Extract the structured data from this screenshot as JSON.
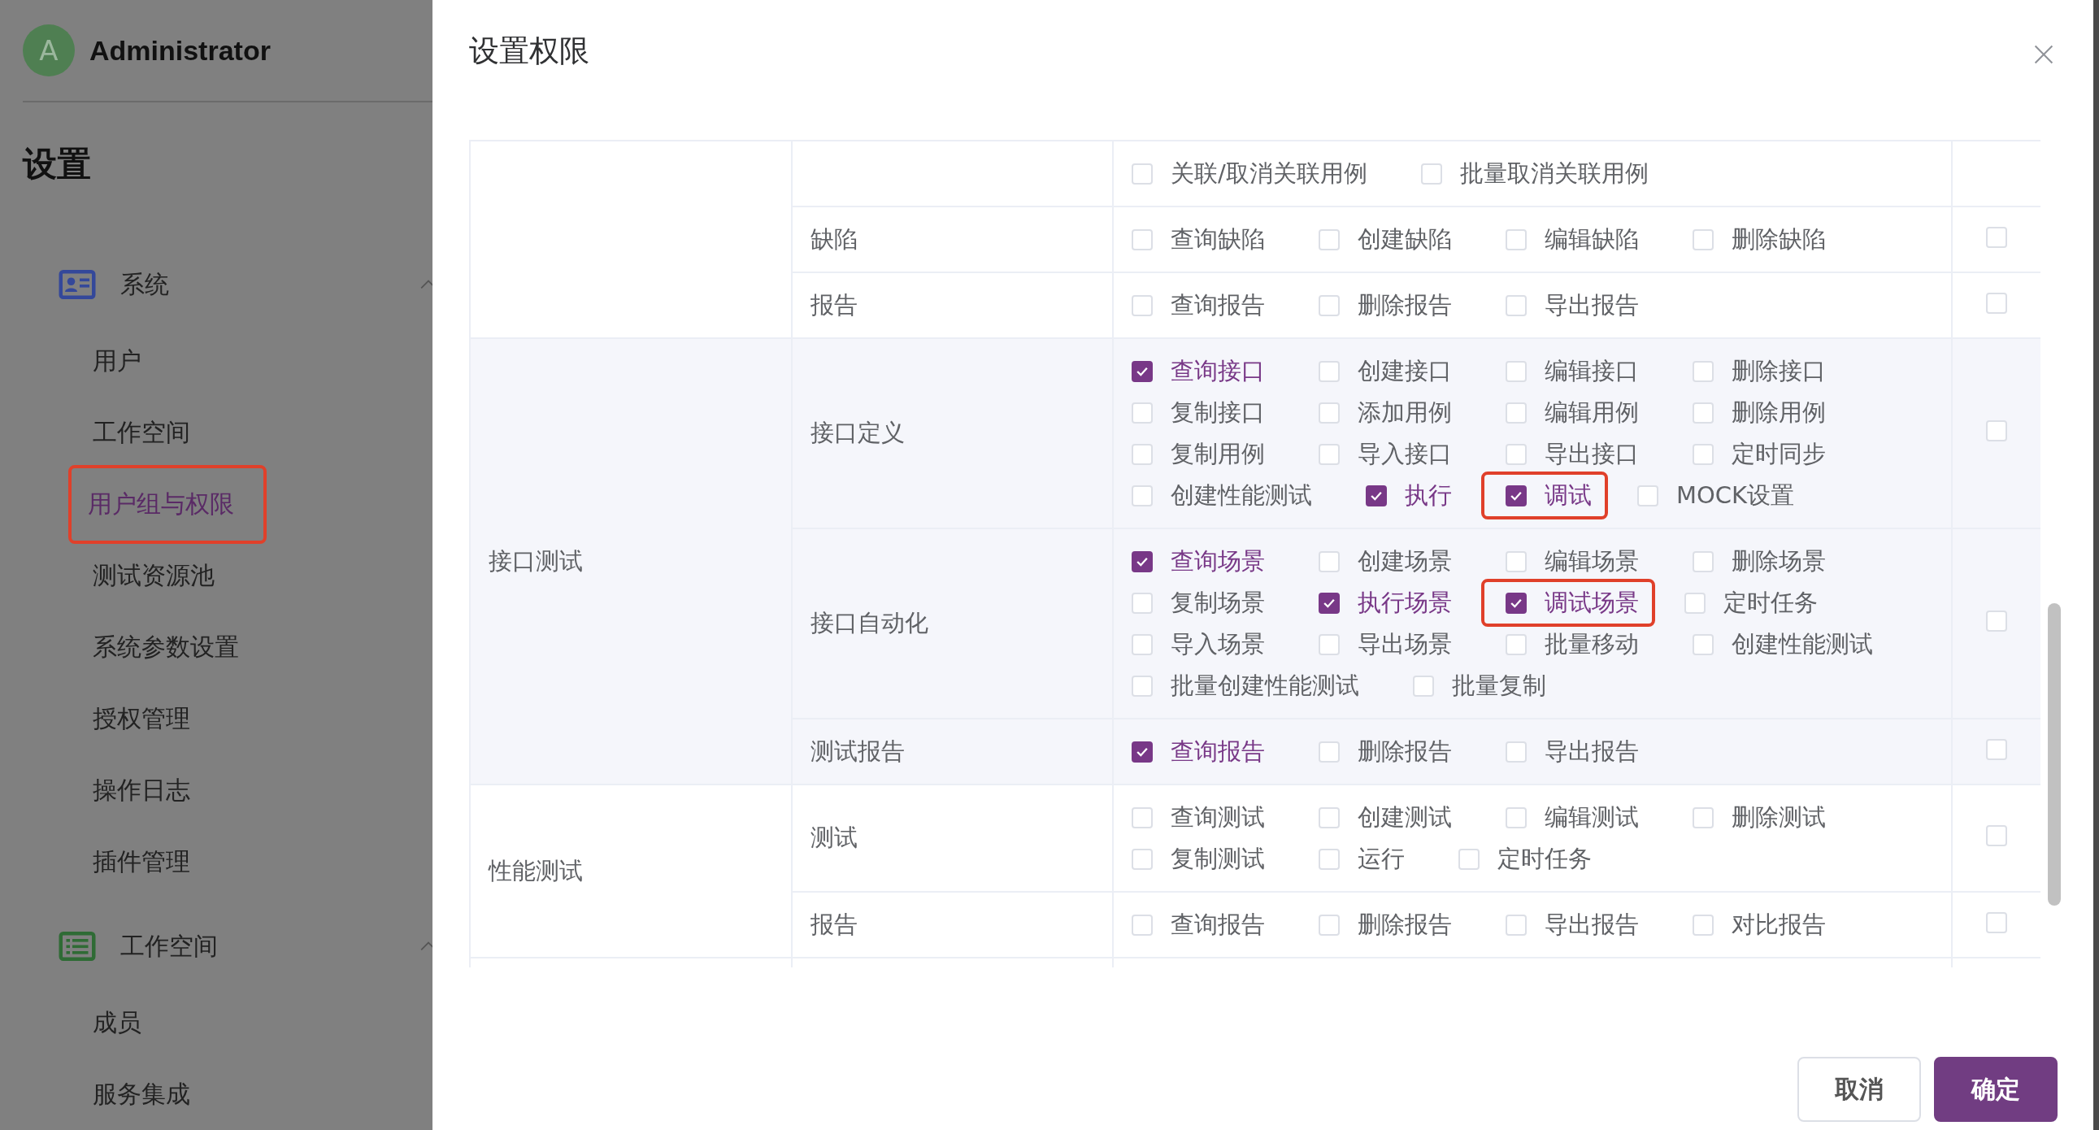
{
  "sidebar": {
    "user": {
      "avatar": "A",
      "name": "Administrator"
    },
    "title": "设置",
    "groups": [
      {
        "label": "系统",
        "kind": "card",
        "expanded": true,
        "items": [
          {
            "label": "用户",
            "selected": false,
            "highlighted": false
          },
          {
            "label": "工作空间",
            "selected": false,
            "highlighted": false
          },
          {
            "label": "用户组与权限",
            "selected": true,
            "highlighted": true
          },
          {
            "label": "测试资源池",
            "selected": false,
            "highlighted": false
          },
          {
            "label": "系统参数设置",
            "selected": false,
            "highlighted": false
          },
          {
            "label": "授权管理",
            "selected": false,
            "highlighted": false
          },
          {
            "label": "操作日志",
            "selected": false,
            "highlighted": false
          },
          {
            "label": "插件管理",
            "selected": false,
            "highlighted": false
          }
        ]
      },
      {
        "label": "工作空间",
        "kind": "list",
        "expanded": true,
        "items": [
          {
            "label": "成员",
            "selected": false,
            "highlighted": false
          },
          {
            "label": "服务集成",
            "selected": false,
            "highlighted": false
          }
        ]
      }
    ]
  },
  "dialog": {
    "title": "设置权限",
    "groups": [
      {
        "hovered": false,
        "rows": [
          {
            "permissions": [
              {
                "label": "关联/取消关联用例",
                "checked": false,
                "marked": false
              },
              {
                "label": "批量取消关联用例",
                "checked": false,
                "marked": false
              }
            ]
          },
          {
            "resource": "缺陷",
            "select_all": {
              "checked": false
            },
            "permissions": [
              {
                "label": "查询缺陷",
                "checked": false,
                "marked": false
              },
              {
                "label": "创建缺陷",
                "checked": false,
                "marked": false
              },
              {
                "label": "编辑缺陷",
                "checked": false,
                "marked": false
              },
              {
                "label": "删除缺陷",
                "checked": false,
                "marked": false
              }
            ]
          },
          {
            "resource": "报告",
            "select_all": {
              "checked": false
            },
            "permissions": [
              {
                "label": "查询报告",
                "checked": false,
                "marked": false
              },
              {
                "label": "删除报告",
                "checked": false,
                "marked": false
              },
              {
                "label": "导出报告",
                "checked": false,
                "marked": false
              }
            ]
          }
        ]
      },
      {
        "name": "接口测试",
        "hovered": true,
        "rows": [
          {
            "resource": "接口定义",
            "select_all": {
              "checked": false
            },
            "permissions": [
              {
                "label": "查询接口",
                "checked": true,
                "marked": false
              },
              {
                "label": "创建接口",
                "checked": false,
                "marked": false
              },
              {
                "label": "编辑接口",
                "checked": false,
                "marked": false
              },
              {
                "label": "删除接口",
                "checked": false,
                "marked": false
              },
              {
                "label": "复制接口",
                "checked": false,
                "marked": false
              },
              {
                "label": "添加用例",
                "checked": false,
                "marked": false
              },
              {
                "label": "编辑用例",
                "checked": false,
                "marked": false
              },
              {
                "label": "删除用例",
                "checked": false,
                "marked": false
              },
              {
                "label": "复制用例",
                "checked": false,
                "marked": false
              },
              {
                "label": "导入接口",
                "checked": false,
                "marked": false
              },
              {
                "label": "导出接口",
                "checked": false,
                "marked": false
              },
              {
                "label": "定时同步",
                "checked": false,
                "marked": false
              },
              {
                "label": "创建性能测试",
                "checked": false,
                "marked": false
              },
              {
                "label": "执行",
                "checked": true,
                "marked": false
              },
              {
                "label": "调试",
                "checked": true,
                "marked": true
              },
              {
                "label": "MOCK设置",
                "checked": false,
                "marked": false
              }
            ]
          },
          {
            "resource": "接口自动化",
            "select_all": {
              "checked": false
            },
            "permissions": [
              {
                "label": "查询场景",
                "checked": true,
                "marked": false
              },
              {
                "label": "创建场景",
                "checked": false,
                "marked": false
              },
              {
                "label": "编辑场景",
                "checked": false,
                "marked": false
              },
              {
                "label": "删除场景",
                "checked": false,
                "marked": false
              },
              {
                "label": "复制场景",
                "checked": false,
                "marked": false
              },
              {
                "label": "执行场景",
                "checked": true,
                "marked": false
              },
              {
                "label": "调试场景",
                "checked": true,
                "marked": true
              },
              {
                "label": "定时任务",
                "checked": false,
                "marked": false
              },
              {
                "label": "导入场景",
                "checked": false,
                "marked": false
              },
              {
                "label": "导出场景",
                "checked": false,
                "marked": false
              },
              {
                "label": "批量移动",
                "checked": false,
                "marked": false
              },
              {
                "label": "创建性能测试",
                "checked": false,
                "marked": false
              },
              {
                "label": "批量创建性能测试",
                "checked": false,
                "marked": false
              },
              {
                "label": "批量复制",
                "checked": false,
                "marked": false
              }
            ]
          },
          {
            "resource": "测试报告",
            "select_all": {
              "checked": false
            },
            "permissions": [
              {
                "label": "查询报告",
                "checked": true,
                "marked": false
              },
              {
                "label": "删除报告",
                "checked": false,
                "marked": false
              },
              {
                "label": "导出报告",
                "checked": false,
                "marked": false
              }
            ]
          }
        ]
      },
      {
        "name": "性能测试",
        "hovered": false,
        "rows": [
          {
            "resource": "测试",
            "select_all": {
              "checked": false
            },
            "permissions": [
              {
                "label": "查询测试",
                "checked": false,
                "marked": false
              },
              {
                "label": "创建测试",
                "checked": false,
                "marked": false
              },
              {
                "label": "编辑测试",
                "checked": false,
                "marked": false
              },
              {
                "label": "删除测试",
                "checked": false,
                "marked": false
              },
              {
                "label": "复制测试",
                "checked": false,
                "marked": false
              },
              {
                "label": "运行",
                "checked": false,
                "marked": false
              },
              {
                "label": "定时任务",
                "checked": false,
                "marked": false
              }
            ]
          },
          {
            "resource": "报告",
            "select_all": {
              "checked": false
            },
            "permissions": [
              {
                "label": "查询报告",
                "checked": false,
                "marked": false
              },
              {
                "label": "删除报告",
                "checked": false,
                "marked": false
              },
              {
                "label": "导出报告",
                "checked": false,
                "marked": false
              },
              {
                "label": "对比报告",
                "checked": false,
                "marked": false
              }
            ]
          }
        ]
      }
    ],
    "buttons": [
      {
        "label": "取消",
        "kind": "default"
      },
      {
        "label": "确定",
        "kind": "primary"
      }
    ]
  }
}
